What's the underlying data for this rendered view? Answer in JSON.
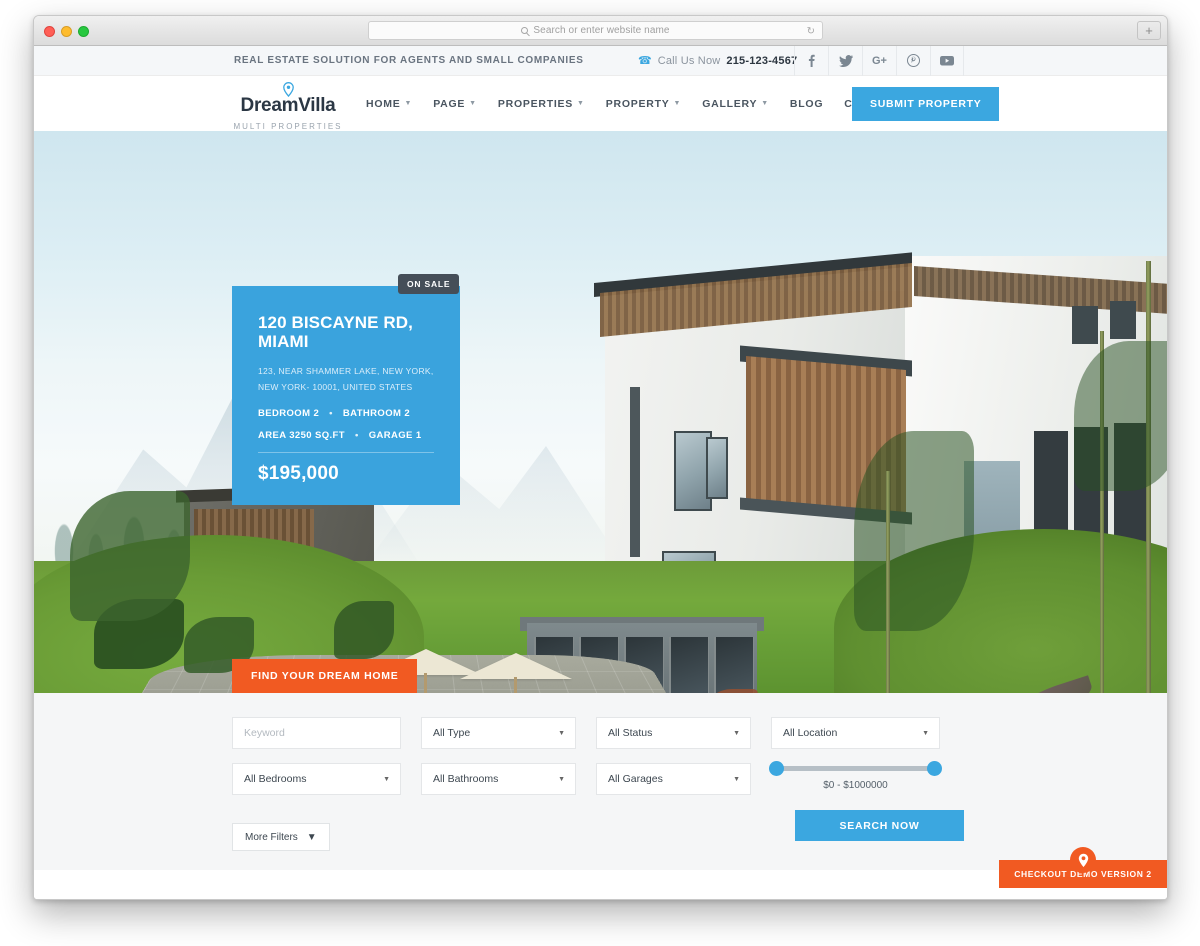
{
  "browser": {
    "address_placeholder": "Search or enter website name",
    "reload_icon": "reload-icon",
    "new_tab_label": "+",
    "traffic_lights": [
      "close",
      "minimize",
      "maximize"
    ]
  },
  "topbar": {
    "tagline": "REAL ESTATE SOLUTION FOR AGENTS AND SMALL COMPANIES",
    "call_label": "Call Us Now",
    "phone": "215-123-4567",
    "phone_icon": "phone-icon",
    "socials": [
      {
        "name": "facebook",
        "glyph": "f"
      },
      {
        "name": "twitter",
        "glyph": "t"
      },
      {
        "name": "google-plus",
        "glyph": "G+"
      },
      {
        "name": "pinterest",
        "glyph": "P"
      },
      {
        "name": "youtube",
        "glyph": "Y"
      }
    ]
  },
  "header": {
    "logo_name_1": "Dream",
    "logo_name_2": "Villa",
    "logo_sub": "MULTI PROPERTIES",
    "logo_icon": "map-pin-icon",
    "nav": [
      {
        "label": "HOME",
        "caret": true
      },
      {
        "label": "PAGE",
        "caret": true
      },
      {
        "label": "PROPERTIES",
        "caret": true
      },
      {
        "label": "PROPERTY",
        "caret": true
      },
      {
        "label": "GALLERY",
        "caret": true
      },
      {
        "label": "BLOG",
        "caret": false
      },
      {
        "label": "CONTACT US",
        "caret": false
      }
    ],
    "submit_button": "SUBMIT PROPERTY"
  },
  "hero": {
    "find_tab": "FIND YOUR DREAM HOME",
    "card": {
      "badge": "ON SALE",
      "title": "120 BISCAYNE RD, MIAMI",
      "address": "123, NEAR SHAMMER LAKE, NEW YORK, NEW YORK- 10001, UNITED STATES",
      "bedroom": "BEDROOM 2",
      "bathroom": "BATHROOM 2",
      "area": "AREA 3250 SQ.FT",
      "garage": "GARAGE 1",
      "separator": "•",
      "price": "$195,000"
    }
  },
  "search": {
    "keyword_placeholder": "Keyword",
    "type": "All Type",
    "status": "All Status",
    "location": "All Location",
    "bedrooms": "All Bedrooms",
    "bathrooms": "All Bathrooms",
    "garages": "All Garages",
    "price_range": "$0 - $1000000",
    "price_min": 0,
    "price_max": 1000000,
    "more_filters": "More Filters",
    "search_button": "SEARCH NOW"
  },
  "demo": {
    "label": "CHECKOUT DEMO VERSION 2",
    "icon": "map-pin-icon"
  },
  "colors": {
    "brand_blue": "#3ba7e0",
    "card_blue": "#3aa3dd",
    "accent_orange": "#f15a22",
    "badge_dark": "#454e58",
    "panel_bg": "#f5f6f7",
    "topbar_bg": "#f5f7f9"
  }
}
